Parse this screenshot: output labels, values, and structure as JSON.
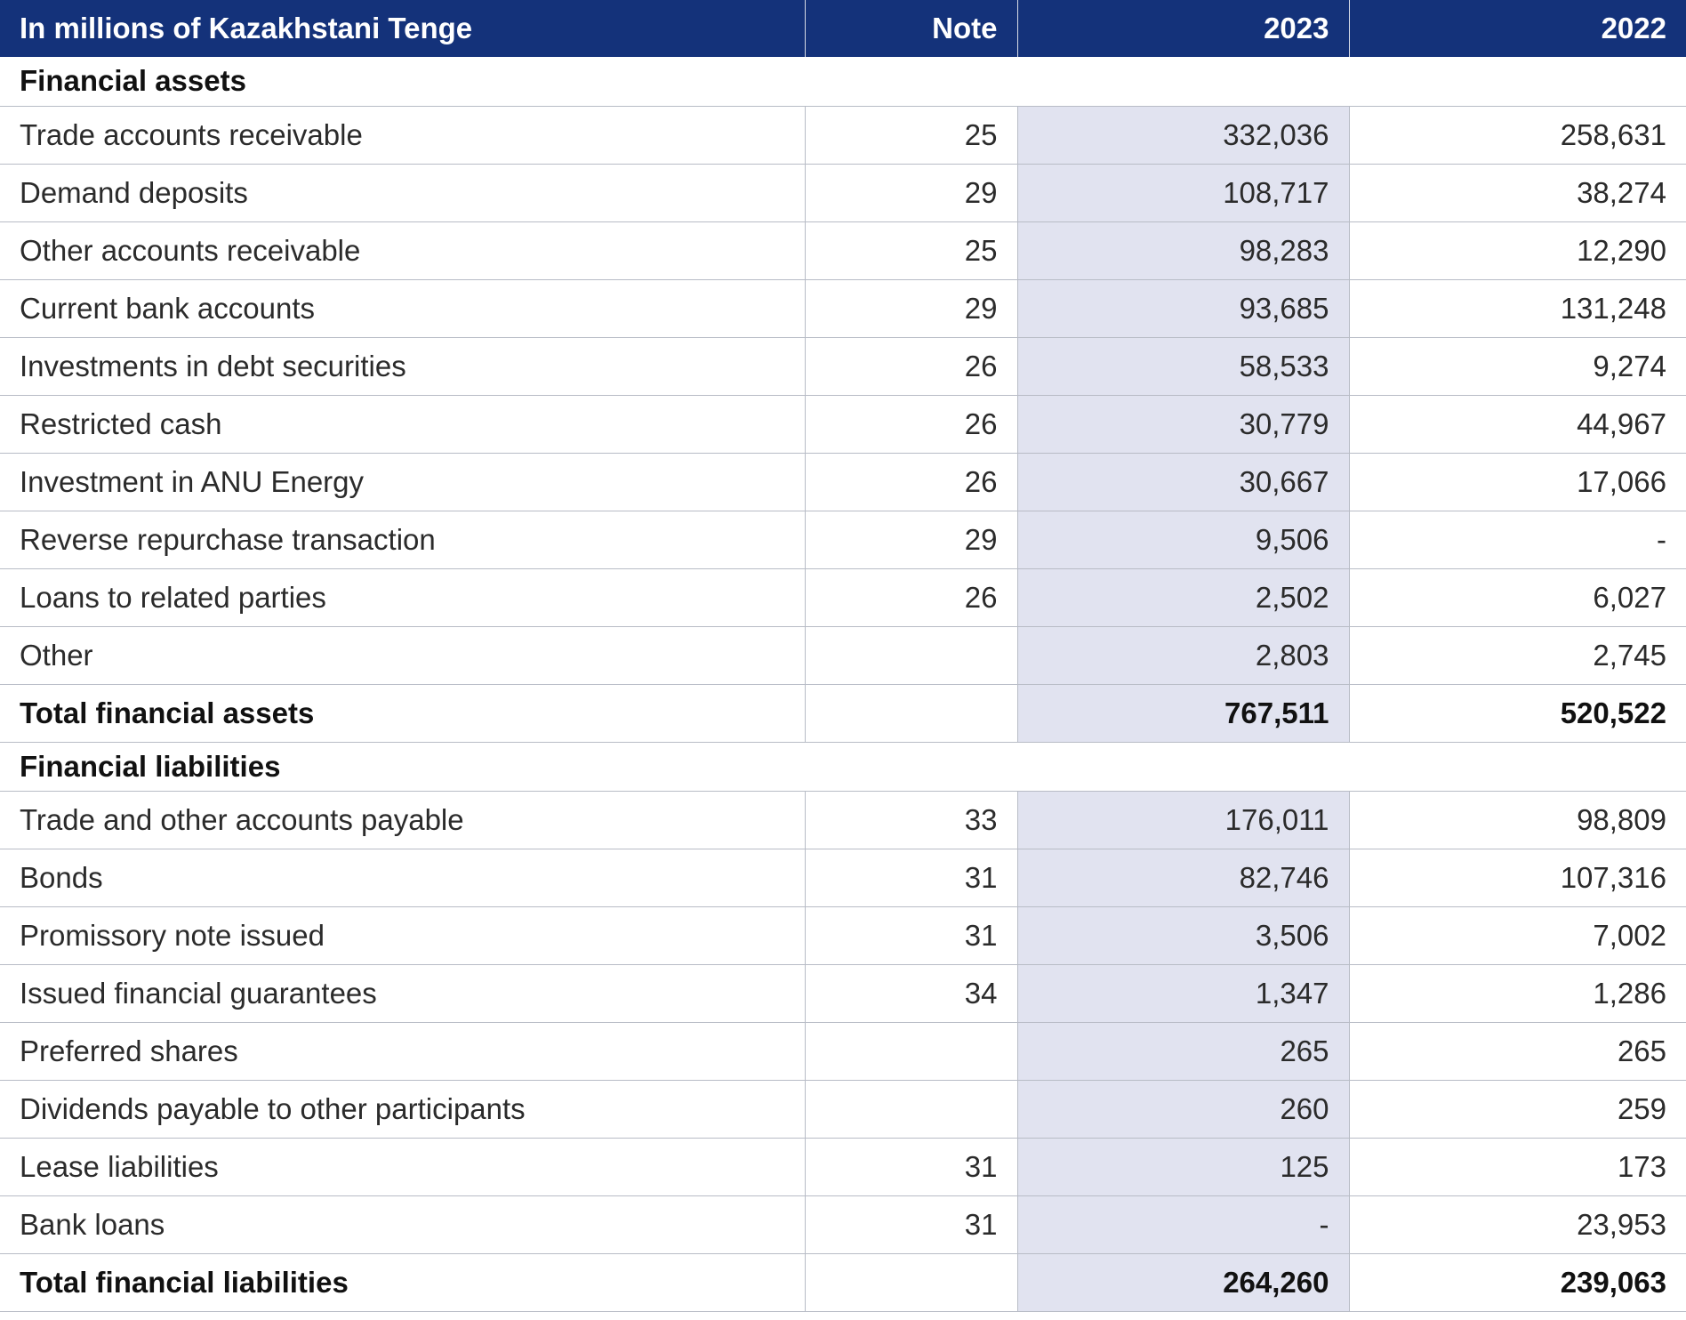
{
  "header": {
    "label": "In millions of Kazakhstani Tenge",
    "note": "Note",
    "y2023": "2023",
    "y2022": "2022"
  },
  "assets": {
    "title": "Financial assets",
    "rows": [
      {
        "label": "Trade accounts receivable",
        "note": "25",
        "v2023": "332,036",
        "v2022": "258,631"
      },
      {
        "label": "Demand deposits",
        "note": "29",
        "v2023": "108,717",
        "v2022": "38,274"
      },
      {
        "label": "Other accounts receivable",
        "note": "25",
        "v2023": "98,283",
        "v2022": "12,290"
      },
      {
        "label": "Current bank accounts",
        "note": "29",
        "v2023": "93,685",
        "v2022": "131,248"
      },
      {
        "label": "Investments in debt securities",
        "note": "26",
        "v2023": "58,533",
        "v2022": "9,274"
      },
      {
        "label": "Restricted cash",
        "note": "26",
        "v2023": "30,779",
        "v2022": "44,967"
      },
      {
        "label": "Investment in ANU Energy",
        "note": "26",
        "v2023": "30,667",
        "v2022": "17,066"
      },
      {
        "label": "Reverse repurchase transaction",
        "note": "29",
        "v2023": "9,506",
        "v2022": "-"
      },
      {
        "label": "Loans to related parties",
        "note": "26",
        "v2023": "2,502",
        "v2022": "6,027"
      },
      {
        "label": "Other",
        "note": "",
        "v2023": "2,803",
        "v2022": "2,745"
      }
    ],
    "total": {
      "label": "Total financial assets",
      "v2023": "767,511",
      "v2022": "520,522"
    }
  },
  "liabilities": {
    "title": "Financial liabilities",
    "rows": [
      {
        "label": "Trade and other accounts payable",
        "note": "33",
        "v2023": "176,011",
        "v2022": "98,809"
      },
      {
        "label": "Bonds",
        "note": "31",
        "v2023": "82,746",
        "v2022": "107,316"
      },
      {
        "label": "Promissory note issued",
        "note": "31",
        "v2023": "3,506",
        "v2022": "7,002"
      },
      {
        "label": "Issued financial guarantees",
        "note": "34",
        "v2023": "1,347",
        "v2022": "1,286"
      },
      {
        "label": "Preferred shares",
        "note": "",
        "v2023": "265",
        "v2022": "265"
      },
      {
        "label": "Dividends payable to other participants",
        "note": "",
        "v2023": "260",
        "v2022": "259"
      },
      {
        "label": "Lease liabilities",
        "note": "31",
        "v2023": "125",
        "v2022": "173"
      },
      {
        "label": "Bank loans",
        "note": "31",
        "v2023": "-",
        "v2022": "23,953"
      }
    ],
    "total": {
      "label": "Total financial liabilities",
      "v2023": "264,260",
      "v2022": "239,063"
    }
  },
  "colors": {
    "header_bg": "#14327a",
    "highlight_col": "#e1e3f0",
    "grid_line": "#b8bcc6"
  }
}
